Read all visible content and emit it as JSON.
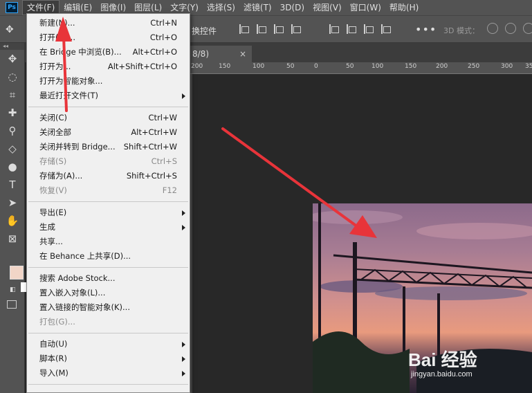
{
  "app": {
    "logo_text": "Ps"
  },
  "menubar": {
    "items": [
      "文件(F)",
      "编辑(E)",
      "图像(I)",
      "图层(L)",
      "文字(Y)",
      "选择(S)",
      "滤镜(T)",
      "3D(D)",
      "视图(V)",
      "窗口(W)",
      "帮助(H)"
    ]
  },
  "options": {
    "transform_label": "换控件",
    "more": "•••",
    "mode_3d": "3D 模式："
  },
  "document": {
    "tab_label": "8/8)",
    "close_glyph": "×"
  },
  "ruler": {
    "labels": [
      "200",
      "150",
      "100",
      "50",
      "0",
      "50",
      "100",
      "150",
      "200",
      "250",
      "300",
      "35"
    ]
  },
  "file_menu": {
    "items": [
      {
        "label": "新建(N)...",
        "shortcut": "Ctrl+N",
        "enabled": true
      },
      {
        "label": "打开(O)...",
        "shortcut": "Ctrl+O",
        "enabled": true
      },
      {
        "label": "在 Bridge 中浏览(B)...",
        "shortcut": "Alt+Ctrl+O",
        "enabled": true
      },
      {
        "label": "打开为...",
        "shortcut": "Alt+Shift+Ctrl+O",
        "enabled": true
      },
      {
        "label": "打开为智能对象...",
        "shortcut": "",
        "enabled": true
      },
      {
        "label": "最近打开文件(T)",
        "shortcut": "",
        "enabled": true,
        "submenu": true
      },
      {
        "label": "关闭(C)",
        "shortcut": "Ctrl+W",
        "enabled": true
      },
      {
        "label": "关闭全部",
        "shortcut": "Alt+Ctrl+W",
        "enabled": true
      },
      {
        "label": "关闭并转到 Bridge...",
        "shortcut": "Shift+Ctrl+W",
        "enabled": true
      },
      {
        "label": "存储(S)",
        "shortcut": "Ctrl+S",
        "enabled": false
      },
      {
        "label": "存储为(A)...",
        "shortcut": "Shift+Ctrl+S",
        "enabled": true
      },
      {
        "label": "恢复(V)",
        "shortcut": "F12",
        "enabled": false
      },
      {
        "label": "导出(E)",
        "shortcut": "",
        "enabled": true,
        "submenu": true
      },
      {
        "label": "生成",
        "shortcut": "",
        "enabled": true,
        "submenu": true
      },
      {
        "label": "共享...",
        "shortcut": "",
        "enabled": true
      },
      {
        "label": "在 Behance 上共享(D)...",
        "shortcut": "",
        "enabled": true
      },
      {
        "label": "搜索 Adobe Stock...",
        "shortcut": "",
        "enabled": true
      },
      {
        "label": "置入嵌入对象(L)...",
        "shortcut": "",
        "enabled": true
      },
      {
        "label": "置入链接的智能对象(K)...",
        "shortcut": "",
        "enabled": true
      },
      {
        "label": "打包(G)...",
        "shortcut": "",
        "enabled": false
      },
      {
        "label": "自动(U)",
        "shortcut": "",
        "enabled": true,
        "submenu": true
      },
      {
        "label": "脚本(R)",
        "shortcut": "",
        "enabled": true,
        "submenu": true
      },
      {
        "label": "导入(M)",
        "shortcut": "",
        "enabled": true,
        "submenu": true
      }
    ]
  },
  "watermark": {
    "brand": "Bai  经验",
    "url": "jingyan.baidu.com"
  },
  "colors": {
    "foreground": "#f1d5c7",
    "menu_bg": "#f0f0f0",
    "annotation": "#e8343a"
  }
}
